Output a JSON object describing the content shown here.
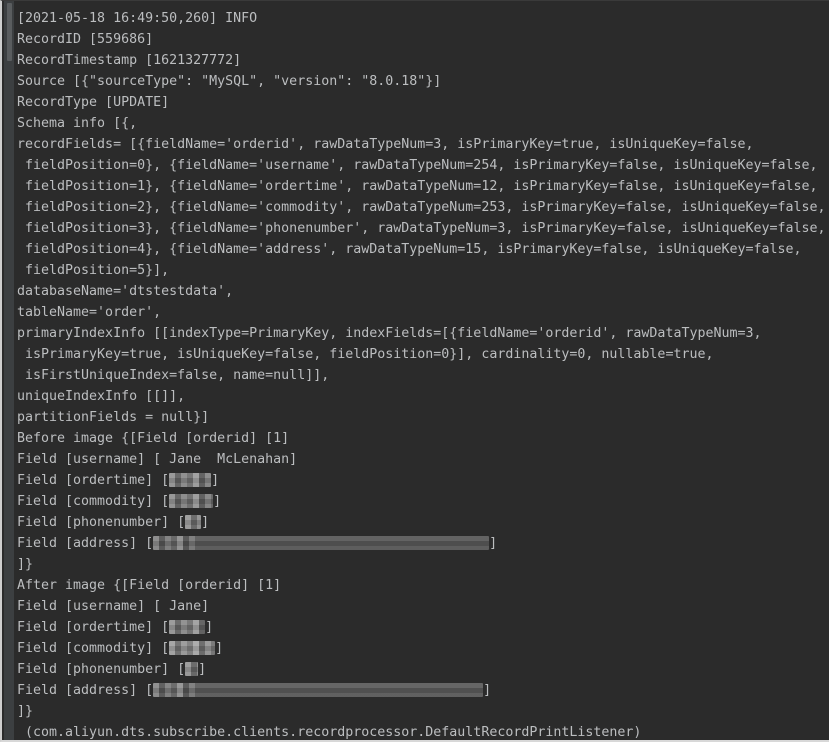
{
  "window": {
    "title": "DTS Record Print Listener Console Output",
    "background_color": "#2b2b2b",
    "text_color": "#bcbec0",
    "scrollbar_thumb_color": "#5a5d5f"
  },
  "log": {
    "header": {
      "timestamp": "[2021-05-18 16:49:50,260]",
      "level": "INFO",
      "line": "[2021-05-18 16:49:50,260] INFO"
    },
    "record_id_line": "RecordID [559686]",
    "record_timestamp_line": "RecordTimestamp [1621327772]",
    "source_line": "Source [{\"sourceType\": \"MySQL\", \"version\": \"8.0.18\"}]",
    "record_type_line": "RecordType [UPDATE]",
    "schema_info_open": "Schema info [{,",
    "record_fields": [
      "recordFields= [{fieldName='orderid', rawDataTypeNum=3, isPrimaryKey=true, isUniqueKey=false,",
      " fieldPosition=0}, {fieldName='username', rawDataTypeNum=254, isPrimaryKey=false, isUniqueKey=false,",
      " fieldPosition=1}, {fieldName='ordertime', rawDataTypeNum=12, isPrimaryKey=false, isUniqueKey=false,",
      " fieldPosition=2}, {fieldName='commodity', rawDataTypeNum=253, isPrimaryKey=false, isUniqueKey=false,",
      " fieldPosition=3}, {fieldName='phonenumber', rawDataTypeNum=3, isPrimaryKey=false, isUniqueKey=false,",
      " fieldPosition=4}, {fieldName='address', rawDataTypeNum=15, isPrimaryKey=false, isUniqueKey=false,",
      " fieldPosition=5}],"
    ],
    "database_name_line": "databaseName='dtstestdata',",
    "table_name_line": "tableName='order',",
    "primary_index_info": [
      "primaryIndexInfo [[indexType=PrimaryKey, indexFields=[{fieldName='orderid', rawDataTypeNum=3,",
      " isPrimaryKey=true, isUniqueKey=false, fieldPosition=0}], cardinality=0, nullable=true,",
      " isFirstUniqueIndex=false, name=null]],"
    ],
    "unique_index_info_line": "uniqueIndexInfo [[]],",
    "partition_fields_line": "partitionFields = null}]",
    "before_image": {
      "open_line": "Before image {[Field [orderid] [1]",
      "fields": [
        {
          "prefix": "Field [username] [ Jane  McLenahan]",
          "redacted": false
        },
        {
          "prefix": "Field [ordertime] [",
          "suffix": "]",
          "redacted": true,
          "redact_class": "w-ordertime"
        },
        {
          "prefix": "Field [commodity] [",
          "suffix": "]",
          "redacted": true,
          "redact_class": "w-commodity"
        },
        {
          "prefix": "Field [phonenumber] [",
          "suffix": "]",
          "redacted": true,
          "redact_class": "w-phone"
        },
        {
          "prefix": "Field [address] [",
          "suffix": "]",
          "redacted": true,
          "redact_class": "w-address"
        }
      ],
      "close_line": "]}"
    },
    "after_image": {
      "open_line": "After image {[Field [orderid] [1]",
      "fields": [
        {
          "prefix": "Field [username] [ Jane]",
          "redacted": false
        },
        {
          "prefix": "Field [ordertime] [",
          "suffix": "]",
          "redacted": true,
          "redact_class": "w-ordertime2"
        },
        {
          "prefix": "Field [commodity] [",
          "suffix": "]",
          "redacted": true,
          "redact_class": "w-commodity2"
        },
        {
          "prefix": "Field [phonenumber] [",
          "suffix": "]",
          "redacted": true,
          "redact_class": "w-phone2"
        },
        {
          "prefix": "Field [address] [",
          "suffix": "]",
          "redacted": true,
          "redact_class": "w-address2"
        }
      ],
      "close_line": "]}"
    },
    "logger_line": " (com.aliyun.dts.subscribe.clients.recordprocessor.DefaultRecordPrintListener)"
  }
}
